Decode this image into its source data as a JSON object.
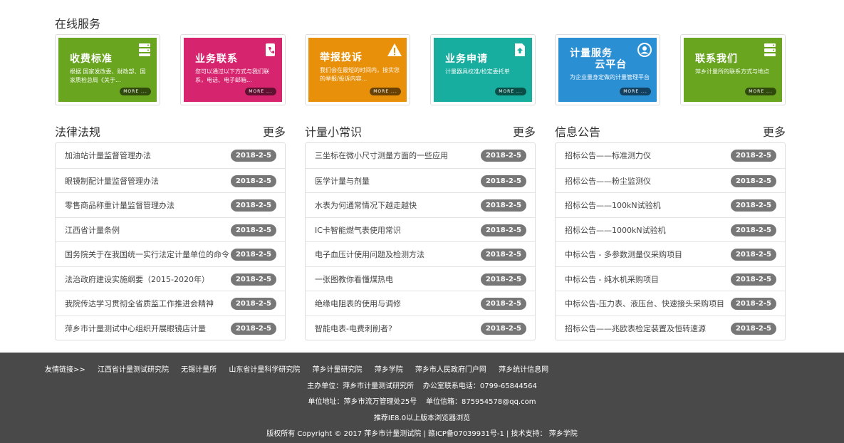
{
  "online_services": {
    "title": "在线服务",
    "cards": [
      {
        "title": "收费标准",
        "desc": "根据 国家发改委、财政部、国家质检总局《关于...",
        "more": "MORE ...",
        "color": "#6aa520",
        "icon": "server-icon"
      },
      {
        "title": "业务联系",
        "desc": "您可以通过以下方式与我们联系，电话、电子邮箱...",
        "more": "MORE ...",
        "color": "#d6246e",
        "icon": "phone-book-icon"
      },
      {
        "title": "举报投诉",
        "desc": "我们会在最短的时间内，接实您的举报/投诉内容...",
        "more": "MORE ...",
        "color": "#e8900a",
        "icon": "warning-icon"
      },
      {
        "title": "业务申请",
        "desc": "计量器具校准/检定委托单",
        "more": "MORE ...",
        "color": "#17aea0",
        "icon": "document-upload-icon"
      },
      {
        "title": "计量服务\n      云平台",
        "desc": "为企业量身定做的计量管理平台",
        "more": "MORE ...",
        "color": "#2b8fd4",
        "icon": "user-icon"
      },
      {
        "title": "联系我们",
        "desc": "萍乡计量所的联系方式与地点",
        "more": "MORE ...",
        "color": "#6aa520",
        "icon": "server-icon"
      }
    ]
  },
  "columns": [
    {
      "title": "法律法规",
      "more": "更多",
      "items": [
        {
          "text": "加油站计量监督管理办法",
          "date": "2018-2-5"
        },
        {
          "text": "眼镜制配计量监督管理办法",
          "date": "2018-2-5"
        },
        {
          "text": "零售商品称重计量监督管理办法",
          "date": "2018-2-5"
        },
        {
          "text": "江西省计量条例",
          "date": "2018-2-5"
        },
        {
          "text": "国务院关于在我国统一实行法定计量单位的命令",
          "date": "2018-2-5"
        },
        {
          "text": "法治政府建设实施纲要（2015-2020年）",
          "date": "2018-2-5"
        },
        {
          "text": "我院传达学习贯彻全省质监工作推进会精神",
          "date": "2018-2-5"
        },
        {
          "text": "萍乡市计量测试中心组织开展眼镜店计量",
          "date": "2018-2-5"
        }
      ]
    },
    {
      "title": "计量小常识",
      "more": "更多",
      "items": [
        {
          "text": "三坐标在微小尺寸测量方面的一些应用",
          "date": "2018-2-5"
        },
        {
          "text": "医学计量与剂量",
          "date": "2018-2-5"
        },
        {
          "text": "水表为何通常情况下越走越快",
          "date": "2018-2-5"
        },
        {
          "text": "IC卡智能燃气表使用常识",
          "date": "2018-2-5"
        },
        {
          "text": "电子血压计使用问题及检测方法",
          "date": "2018-2-5"
        },
        {
          "text": "一张图教你看懂煤热电",
          "date": "2018-2-5"
        },
        {
          "text": "绝缘电阻表的使用与调修",
          "date": "2018-2-5"
        },
        {
          "text": "智能电表-电费刺削者?",
          "date": "2018-2-5"
        }
      ]
    },
    {
      "title": "信息公告",
      "more": "更多",
      "items": [
        {
          "text": "招标公告——标准测力仪",
          "date": "2018-2-5"
        },
        {
          "text": "招标公告——粉尘监测仪",
          "date": "2018-2-5"
        },
        {
          "text": "招标公告——100kN试验机",
          "date": "2018-2-5"
        },
        {
          "text": "招标公告——1000kN试验机",
          "date": "2018-2-5"
        },
        {
          "text": "中标公告 - 多参数测量仪采购项目",
          "date": "2018-2-5"
        },
        {
          "text": "中标公告 - 纯水机采购项目",
          "date": "2018-2-5"
        },
        {
          "text": "中标公告-压力表、液压台、快速接头采购项目",
          "date": "2018-2-5"
        },
        {
          "text": "招标公告——兆欧表检定装置及恒转速源",
          "date": "2018-2-5"
        }
      ]
    }
  ],
  "footer": {
    "links_label": "友情链接>>",
    "links": [
      "江西省计量测试研究院",
      "无锡计量所",
      "山东省计量科学研究院",
      "萍乡计量研究院",
      "萍乡学院",
      "萍乡市人民政府门户网",
      "萍乡统计信息网"
    ],
    "line1": "主办单位：萍乡市计量测试研究所    办公室联系电话：0799-65844564",
    "line2": "单位地址：萍乡市流万管理处25号    单位信箱：875954578@qq.com",
    "line3": "推荐IE8.0以上版本浏览器浏览",
    "line4": "版权所有 Copyright © 2017 萍乡市计量测试院 | 赣ICP备07039931号-1 | 技术支持： 萍乡学院"
  }
}
